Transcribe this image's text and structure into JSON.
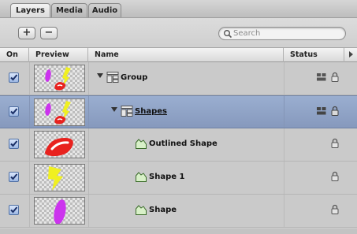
{
  "tabs": [
    {
      "label": "Layers",
      "active": true
    },
    {
      "label": "Media",
      "active": false
    },
    {
      "label": "Audio",
      "active": false
    }
  ],
  "toolbar": {
    "add_label": "+",
    "remove_label": "−",
    "search_placeholder": "Search"
  },
  "columns": {
    "on": "On",
    "preview": "Preview",
    "name": "Name",
    "status": "Status"
  },
  "rows": [
    {
      "name": "Group",
      "kind": "group",
      "checked": true,
      "selected": false,
      "preview": "pink-yellow-small"
    },
    {
      "name": "Shapes",
      "kind": "group",
      "checked": true,
      "selected": true,
      "preview": "pink-yellow-small"
    },
    {
      "name": "Outlined Shape",
      "kind": "shape",
      "checked": true,
      "selected": false,
      "preview": "red-outlined"
    },
    {
      "name": "Shape 1",
      "kind": "shape",
      "checked": true,
      "selected": false,
      "preview": "yellow-bolt"
    },
    {
      "name": "Shape",
      "kind": "shape",
      "checked": true,
      "selected": false,
      "preview": "purple-blob"
    }
  ],
  "colors": {
    "selection": "#8a9dc1",
    "checkbox": "#4f6fa3",
    "purple": "#cc33ee",
    "yellow": "#f0f020",
    "red": "#e8221e"
  }
}
